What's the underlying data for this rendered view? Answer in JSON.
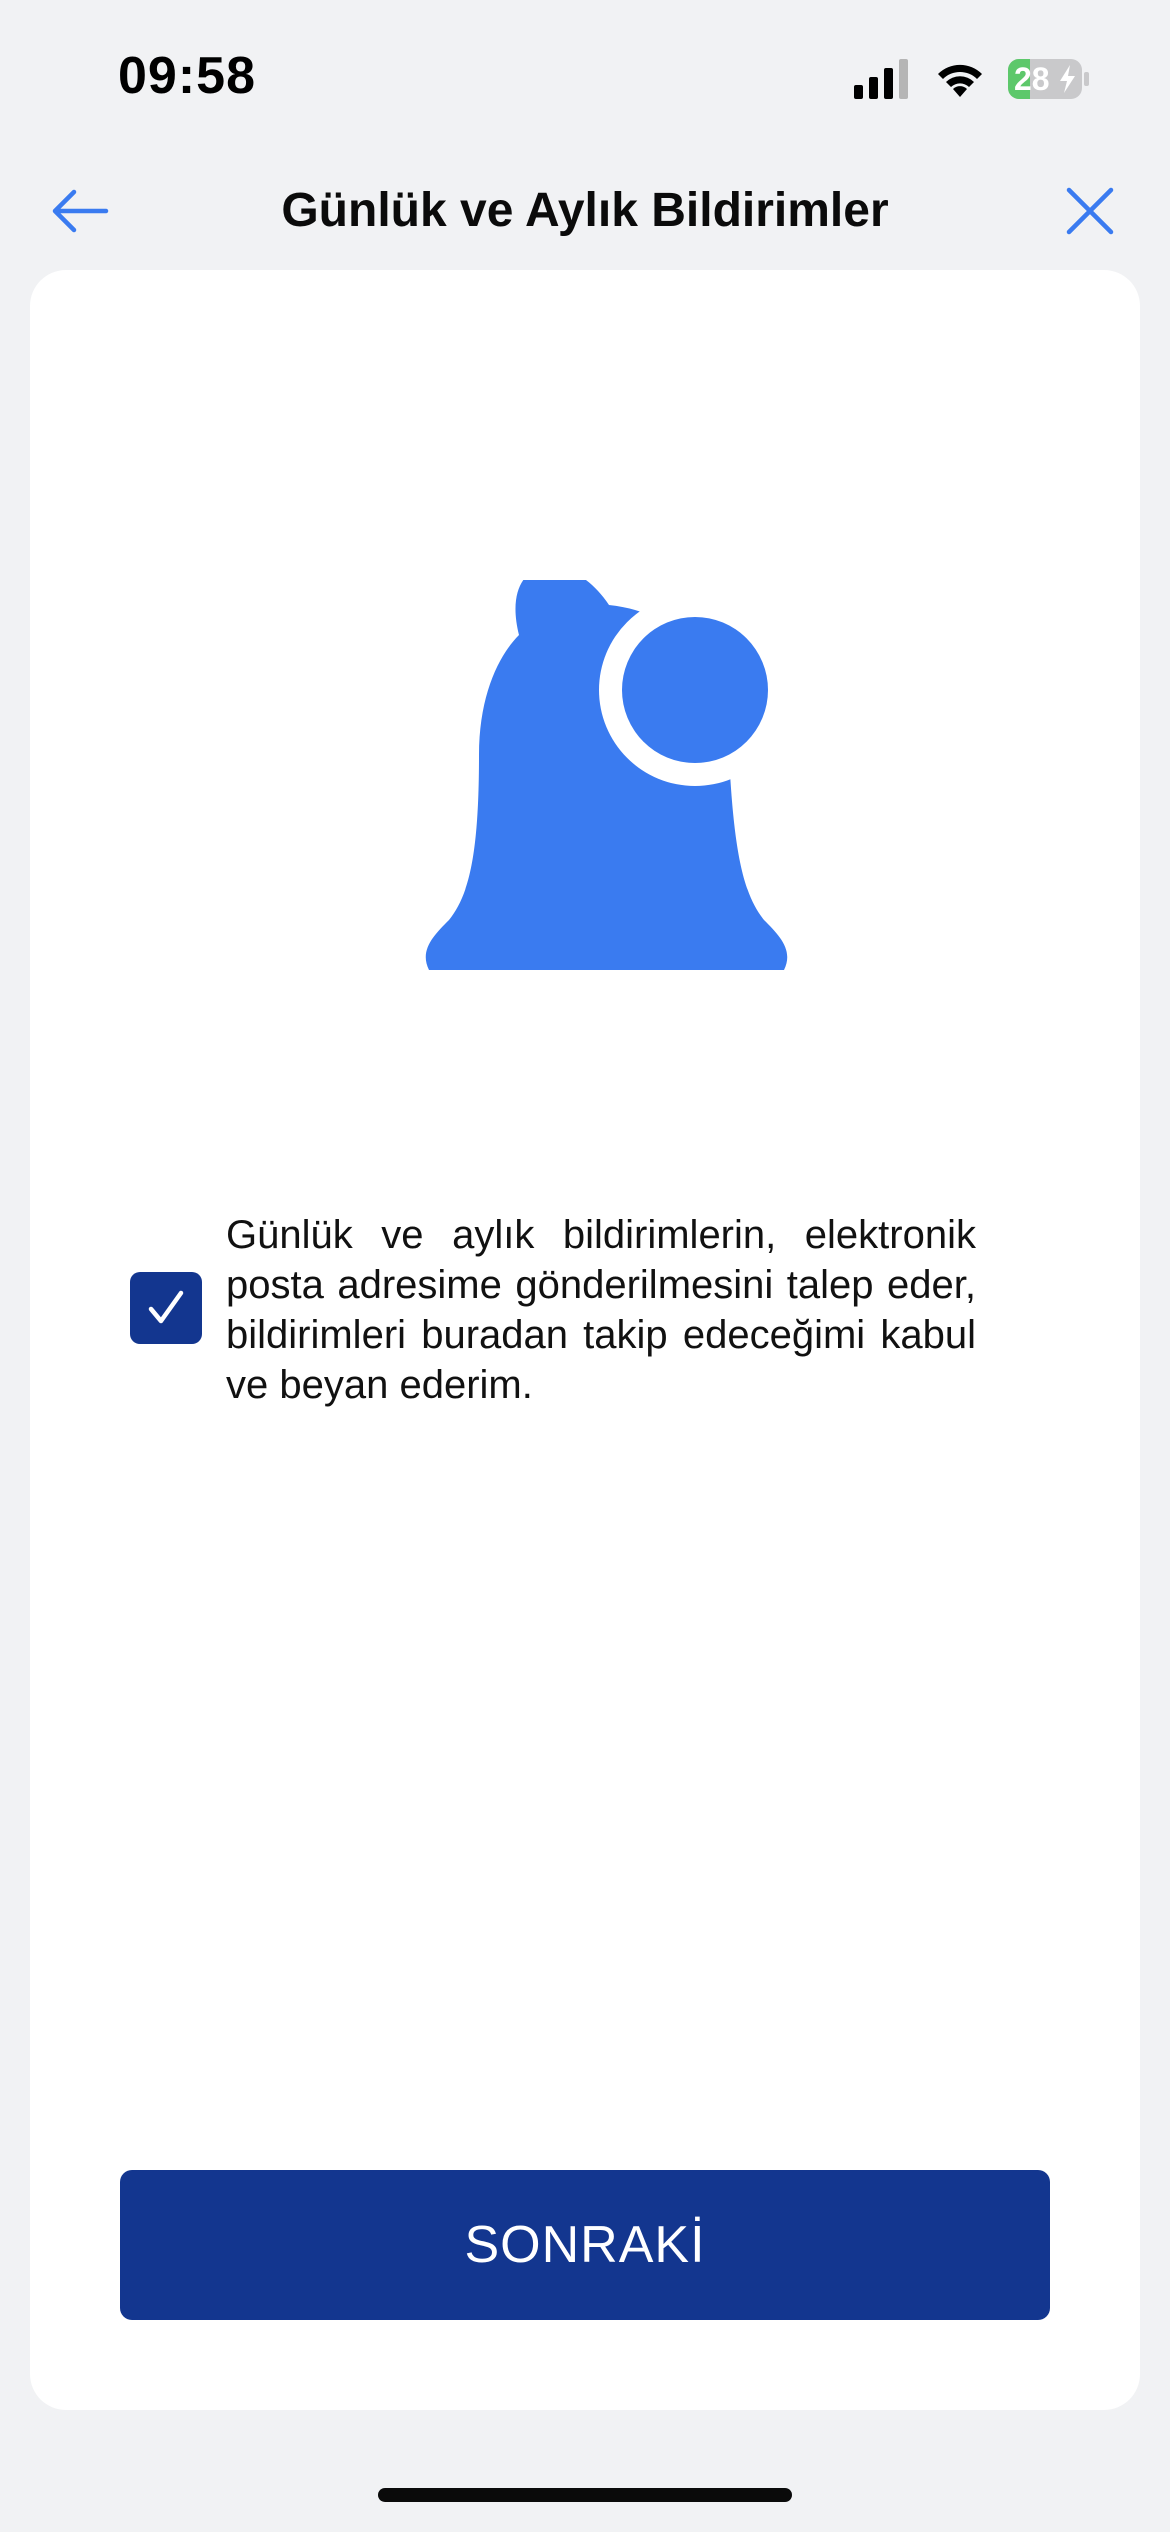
{
  "status_bar": {
    "time": "09:58",
    "battery_level": "28",
    "battery_color": "#5DC86B",
    "icons": [
      "signal-icon",
      "wifi-icon",
      "battery-icon",
      "charging-bolt-icon"
    ]
  },
  "header": {
    "title": "Günlük ve Aylık Bildirimler",
    "back_icon": "arrow-left-icon",
    "close_icon": "close-icon",
    "accent_color": "#3A7BF0"
  },
  "illustration": {
    "icon": "notification-bell-icon",
    "color": "#3A7BF0"
  },
  "consent": {
    "checked": true,
    "text": "Günlük ve aylık bildirimlerin, elektronik posta adresime gönderilmesini talep eder, bildirimleri buradan takip edeceğimi kabul ve beyan ederim."
  },
  "actions": {
    "next_label": "SONRAKİ",
    "button_color": "#13368F"
  }
}
